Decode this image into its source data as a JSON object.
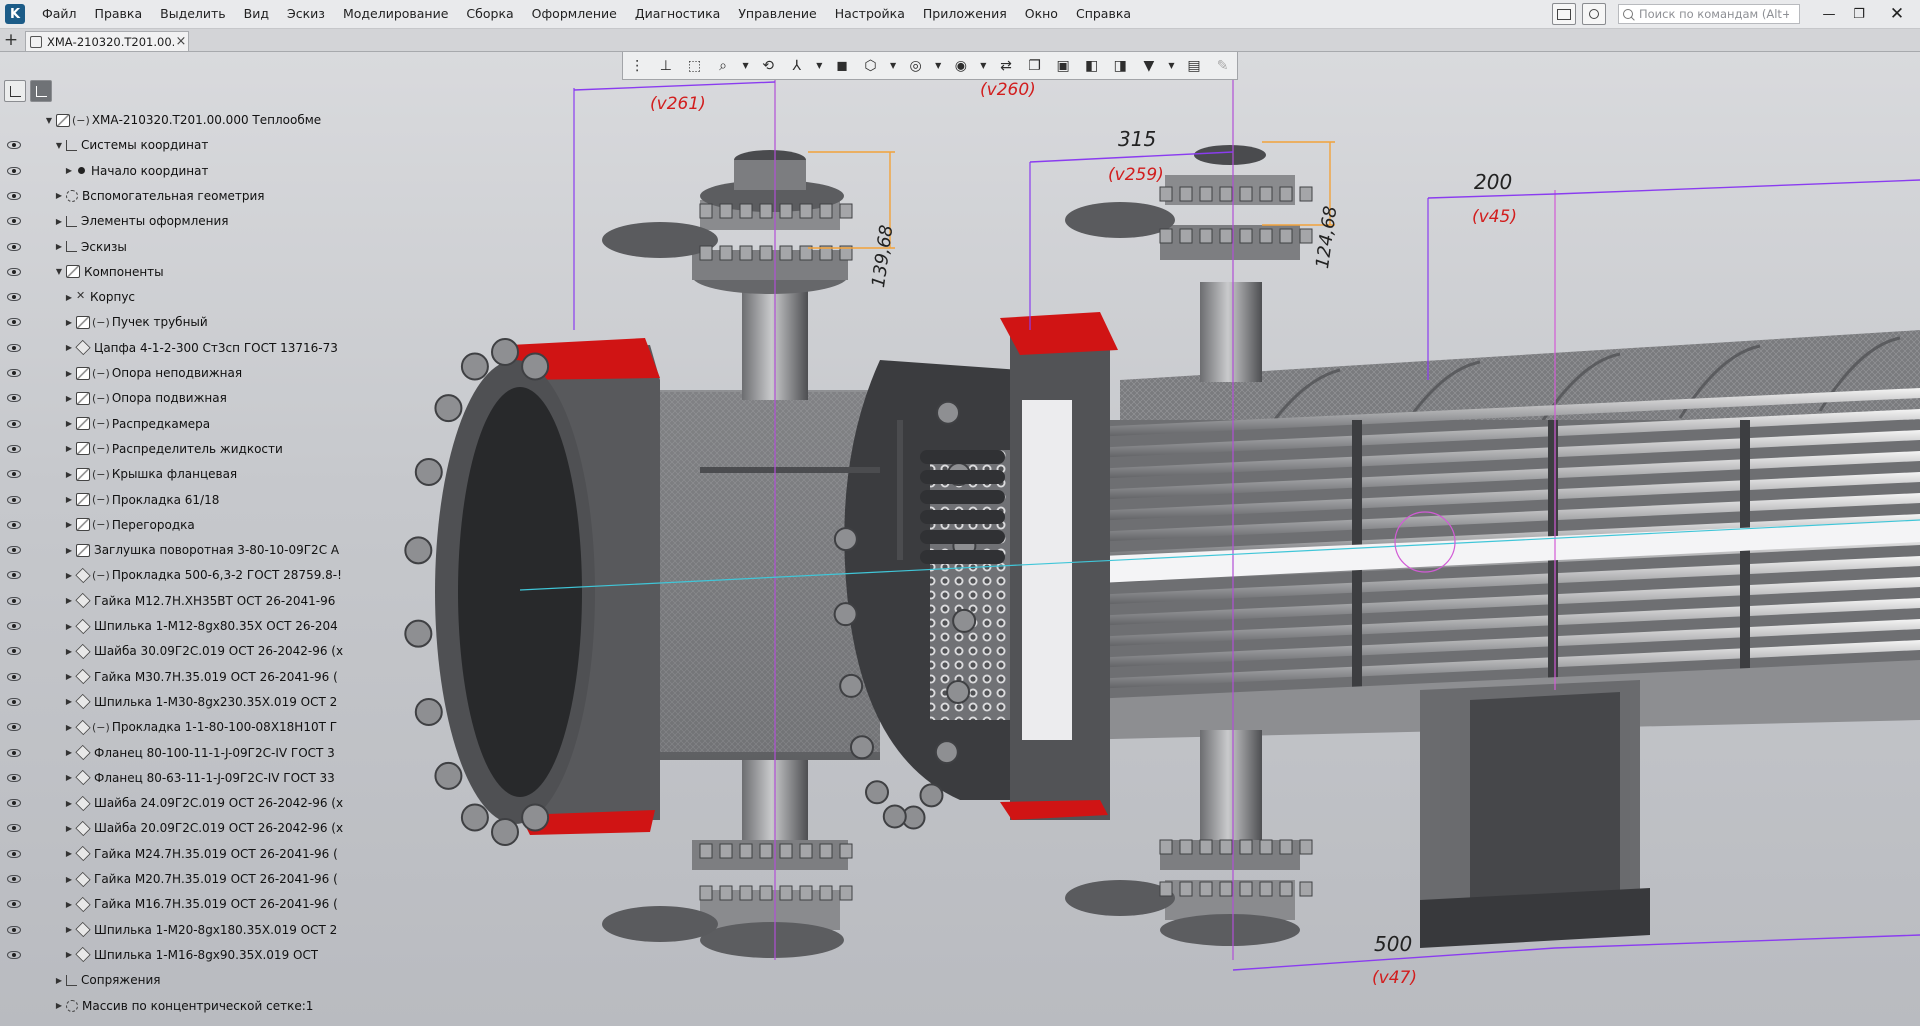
{
  "menu": {
    "logo": "K",
    "items": [
      "Файл",
      "Правка",
      "Выделить",
      "Вид",
      "Эскиз",
      "Моделирование",
      "Сборка",
      "Оформление",
      "Диагностика",
      "Управление",
      "Настройка",
      "Приложения",
      "Окно",
      "Справка"
    ],
    "search_placeholder": "Поиск по командам (Alt+/)"
  },
  "tabs": {
    "add": "+",
    "document_title": "ХМА-210320.Т201.00...",
    "close": "×"
  },
  "tree": {
    "rows": [
      {
        "label": "ХМА-210320.Т201.00.000 Теплообме",
        "icon": "asm",
        "tag": "(−)",
        "expanded": true,
        "eye": false
      },
      {
        "label": "Системы координат",
        "icon": "sys",
        "tag": "",
        "expanded": true,
        "eye": true
      },
      {
        "label": "Начало координат",
        "icon": "dot",
        "tag": "",
        "expanded": false,
        "eye": true
      },
      {
        "label": "Вспомогательная геометрия",
        "icon": "geom",
        "tag": "",
        "expanded": false,
        "eye": true
      },
      {
        "label": "Элементы оформления",
        "icon": "sys",
        "tag": "",
        "expanded": false,
        "eye": true
      },
      {
        "label": "Эскизы",
        "icon": "sys",
        "tag": "",
        "expanded": false,
        "eye": true
      },
      {
        "label": "Компоненты",
        "icon": "asm",
        "tag": "",
        "expanded": true,
        "eye": true
      },
      {
        "label": "Корпус",
        "icon": "pin",
        "tag": "",
        "expanded": false,
        "eye": true
      },
      {
        "label": "Пучек трубный",
        "icon": "asm",
        "tag": "(−)",
        "expanded": false,
        "eye": true
      },
      {
        "label": "Цапфа 4-1-2-300 Ст3сп ГОСТ 13716-73",
        "icon": "part",
        "tag": "",
        "expanded": false,
        "eye": true
      },
      {
        "label": "Опора неподвижная",
        "icon": "asm",
        "tag": "(−)",
        "expanded": false,
        "eye": true
      },
      {
        "label": "Опора подвижная",
        "icon": "asm",
        "tag": "(−)",
        "expanded": false,
        "eye": true
      },
      {
        "label": "Распредкамера",
        "icon": "asm",
        "tag": "(−)",
        "expanded": false,
        "eye": true
      },
      {
        "label": "Распределитель жидкости",
        "icon": "asm",
        "tag": "(−)",
        "expanded": false,
        "eye": true
      },
      {
        "label": "Крышка фланцевая",
        "icon": "asm",
        "tag": "(−)",
        "expanded": false,
        "eye": true
      },
      {
        "label": "Прокладка 61/18",
        "icon": "asm",
        "tag": "(−)",
        "expanded": false,
        "eye": true
      },
      {
        "label": "Перегородка",
        "icon": "asm",
        "tag": "(−)",
        "expanded": false,
        "eye": true
      },
      {
        "label": "Заглушка поворотная 3-80-10-09Г2С А",
        "icon": "asm",
        "tag": "",
        "expanded": false,
        "eye": true
      },
      {
        "label": "Прокладка 500-6,3-2 ГОСТ 28759.8-!",
        "icon": "part",
        "tag": "(−)",
        "expanded": false,
        "eye": true
      },
      {
        "label": "Гайка М12.7Н.ХН35ВТ ОСТ 26-2041-96",
        "icon": "part",
        "tag": "",
        "expanded": false,
        "eye": true
      },
      {
        "label": "Шпилька 1-М12-8gх80.35Х ОСТ 26-204",
        "icon": "part",
        "tag": "",
        "expanded": false,
        "eye": true
      },
      {
        "label": "Шайба 30.09Г2С.019 ОСТ 26-2042-96 (х",
        "icon": "part",
        "tag": "",
        "expanded": false,
        "eye": true
      },
      {
        "label": "Гайка М30.7Н.35.019 ОСТ 26-2041-96 (",
        "icon": "part",
        "tag": "",
        "expanded": false,
        "eye": true
      },
      {
        "label": "Шпилька 1-М30-8gх230.35Х.019 ОСТ 2",
        "icon": "part",
        "tag": "",
        "expanded": false,
        "eye": true
      },
      {
        "label": "Прокладка 1-1-80-100-08Х18Н10Т Г",
        "icon": "part",
        "tag": "(−)",
        "expanded": false,
        "eye": true
      },
      {
        "label": "Фланец 80-100-11-1-J-09Г2С-IV ГОСТ 3",
        "icon": "part",
        "tag": "",
        "expanded": false,
        "eye": true
      },
      {
        "label": "Фланец 80-63-11-1-J-09Г2С-IV ГОСТ 33",
        "icon": "part",
        "tag": "",
        "expanded": false,
        "eye": true
      },
      {
        "label": "Шайба 24.09Г2С.019 ОСТ 26-2042-96 (х",
        "icon": "part",
        "tag": "",
        "expanded": false,
        "eye": true
      },
      {
        "label": "Шайба 20.09Г2С.019 ОСТ 26-2042-96 (х",
        "icon": "part",
        "tag": "",
        "expanded": false,
        "eye": true
      },
      {
        "label": "Гайка М24.7Н.35.019 ОСТ 26-2041-96 (",
        "icon": "part",
        "tag": "",
        "expanded": false,
        "eye": true
      },
      {
        "label": "Гайка М20.7Н.35.019 ОСТ 26-2041-96 (",
        "icon": "part",
        "tag": "",
        "expanded": false,
        "eye": true
      },
      {
        "label": "Гайка М16.7Н.35.019 ОСТ 26-2041-96 (",
        "icon": "part",
        "tag": "",
        "expanded": false,
        "eye": true
      },
      {
        "label": "Шпилька 1-М20-8gх180.35Х.019 ОСТ 2",
        "icon": "part",
        "tag": "",
        "expanded": false,
        "eye": true
      },
      {
        "label": "Шпилька 1-М16-8gх90.35Х.019 ОСТ",
        "icon": "part",
        "tag": "",
        "expanded": false,
        "eye": true
      },
      {
        "label": "Сопряжения",
        "icon": "sys",
        "tag": "",
        "expanded": false,
        "eye": false
      },
      {
        "label": "Массив по концентрической сетке:1",
        "icon": "geom",
        "tag": "",
        "expanded": false,
        "eye": false
      }
    ]
  },
  "dimensions": {
    "d315": "315",
    "d200": "200",
    "d500": "500",
    "d139": "139,68",
    "d124": "124,68",
    "v261": "(v261)",
    "v260": "(v260)",
    "v259": "(v259)",
    "v45": "(v45)",
    "v47": "(v47)"
  },
  "colors": {
    "gasket_red": "#d01414",
    "dimension_purple": "#8a3cf0",
    "dimension_orange": "#f2a23a",
    "steel_dark": "#4a4b4e",
    "steel_mid": "#8c8d90"
  }
}
